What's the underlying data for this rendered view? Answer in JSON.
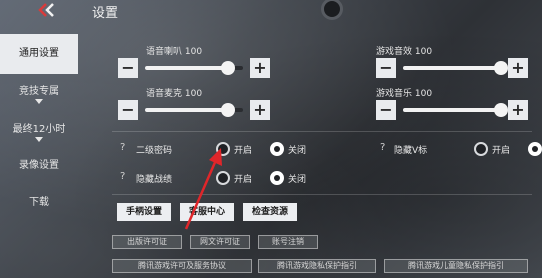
{
  "header": {
    "title": "设置"
  },
  "sidebar": {
    "items": [
      {
        "label": "通用设置",
        "active": true
      },
      {
        "label": "竞技专属",
        "expandable": true
      },
      {
        "label": "最终12小时",
        "expandable": true
      },
      {
        "label": "录像设置"
      },
      {
        "label": "下载"
      }
    ]
  },
  "sliders": [
    {
      "label": "语音喇叭",
      "value": "100",
      "level": 0.85
    },
    {
      "label": "游戏音效",
      "value": "100",
      "level": 1.0
    },
    {
      "label": "语音麦克",
      "value": "100",
      "level": 0.85
    },
    {
      "label": "游戏音乐",
      "value": "100",
      "level": 1.0
    }
  ],
  "toggles": {
    "second_password": {
      "label": "二级密码",
      "on": "开启",
      "off": "关闭",
      "selected": "off"
    },
    "hide_v": {
      "label": "隐藏V标",
      "on": "开启",
      "off": "",
      "selected": "off"
    },
    "hide_record": {
      "label": "隐藏战绩",
      "on": "开启",
      "off": "关闭",
      "selected": "off"
    }
  },
  "actions": {
    "controller": "手柄设置",
    "support": "客服中心",
    "check_resources": "检查资源"
  },
  "links": {
    "publish_license": "出版许可证",
    "net_culture_license": "网文许可证",
    "account_cancel": "账号注销",
    "service_agreement": "腾讯游戏许可及服务协议",
    "privacy_guide": "腾讯游戏隐私保护指引",
    "child_privacy": "腾讯游戏儿童隐私保护指引"
  },
  "colors": {
    "accent_arrow": "#e0262a",
    "panel_light": "#e9ebee"
  }
}
